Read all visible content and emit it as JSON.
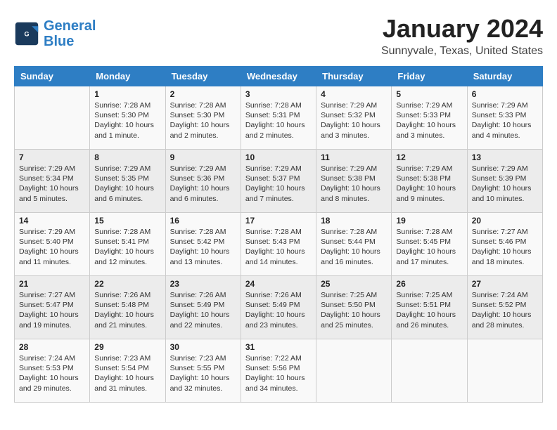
{
  "header": {
    "title": "January 2024",
    "subtitle": "Sunnyvale, Texas, United States",
    "logo_general": "General",
    "logo_blue": "Blue"
  },
  "columns": [
    "Sunday",
    "Monday",
    "Tuesday",
    "Wednesday",
    "Thursday",
    "Friday",
    "Saturday"
  ],
  "weeks": [
    [
      {
        "day": "",
        "info": ""
      },
      {
        "day": "1",
        "info": "Sunrise: 7:28 AM\nSunset: 5:30 PM\nDaylight: 10 hours\nand 1 minute."
      },
      {
        "day": "2",
        "info": "Sunrise: 7:28 AM\nSunset: 5:30 PM\nDaylight: 10 hours\nand 2 minutes."
      },
      {
        "day": "3",
        "info": "Sunrise: 7:28 AM\nSunset: 5:31 PM\nDaylight: 10 hours\nand 2 minutes."
      },
      {
        "day": "4",
        "info": "Sunrise: 7:29 AM\nSunset: 5:32 PM\nDaylight: 10 hours\nand 3 minutes."
      },
      {
        "day": "5",
        "info": "Sunrise: 7:29 AM\nSunset: 5:33 PM\nDaylight: 10 hours\nand 3 minutes."
      },
      {
        "day": "6",
        "info": "Sunrise: 7:29 AM\nSunset: 5:33 PM\nDaylight: 10 hours\nand 4 minutes."
      }
    ],
    [
      {
        "day": "7",
        "info": "Sunrise: 7:29 AM\nSunset: 5:34 PM\nDaylight: 10 hours\nand 5 minutes."
      },
      {
        "day": "8",
        "info": "Sunrise: 7:29 AM\nSunset: 5:35 PM\nDaylight: 10 hours\nand 6 minutes."
      },
      {
        "day": "9",
        "info": "Sunrise: 7:29 AM\nSunset: 5:36 PM\nDaylight: 10 hours\nand 6 minutes."
      },
      {
        "day": "10",
        "info": "Sunrise: 7:29 AM\nSunset: 5:37 PM\nDaylight: 10 hours\nand 7 minutes."
      },
      {
        "day": "11",
        "info": "Sunrise: 7:29 AM\nSunset: 5:38 PM\nDaylight: 10 hours\nand 8 minutes."
      },
      {
        "day": "12",
        "info": "Sunrise: 7:29 AM\nSunset: 5:38 PM\nDaylight: 10 hours\nand 9 minutes."
      },
      {
        "day": "13",
        "info": "Sunrise: 7:29 AM\nSunset: 5:39 PM\nDaylight: 10 hours\nand 10 minutes."
      }
    ],
    [
      {
        "day": "14",
        "info": "Sunrise: 7:29 AM\nSunset: 5:40 PM\nDaylight: 10 hours\nand 11 minutes."
      },
      {
        "day": "15",
        "info": "Sunrise: 7:28 AM\nSunset: 5:41 PM\nDaylight: 10 hours\nand 12 minutes."
      },
      {
        "day": "16",
        "info": "Sunrise: 7:28 AM\nSunset: 5:42 PM\nDaylight: 10 hours\nand 13 minutes."
      },
      {
        "day": "17",
        "info": "Sunrise: 7:28 AM\nSunset: 5:43 PM\nDaylight: 10 hours\nand 14 minutes."
      },
      {
        "day": "18",
        "info": "Sunrise: 7:28 AM\nSunset: 5:44 PM\nDaylight: 10 hours\nand 16 minutes."
      },
      {
        "day": "19",
        "info": "Sunrise: 7:28 AM\nSunset: 5:45 PM\nDaylight: 10 hours\nand 17 minutes."
      },
      {
        "day": "20",
        "info": "Sunrise: 7:27 AM\nSunset: 5:46 PM\nDaylight: 10 hours\nand 18 minutes."
      }
    ],
    [
      {
        "day": "21",
        "info": "Sunrise: 7:27 AM\nSunset: 5:47 PM\nDaylight: 10 hours\nand 19 minutes."
      },
      {
        "day": "22",
        "info": "Sunrise: 7:26 AM\nSunset: 5:48 PM\nDaylight: 10 hours\nand 21 minutes."
      },
      {
        "day": "23",
        "info": "Sunrise: 7:26 AM\nSunset: 5:49 PM\nDaylight: 10 hours\nand 22 minutes."
      },
      {
        "day": "24",
        "info": "Sunrise: 7:26 AM\nSunset: 5:49 PM\nDaylight: 10 hours\nand 23 minutes."
      },
      {
        "day": "25",
        "info": "Sunrise: 7:25 AM\nSunset: 5:50 PM\nDaylight: 10 hours\nand 25 minutes."
      },
      {
        "day": "26",
        "info": "Sunrise: 7:25 AM\nSunset: 5:51 PM\nDaylight: 10 hours\nand 26 minutes."
      },
      {
        "day": "27",
        "info": "Sunrise: 7:24 AM\nSunset: 5:52 PM\nDaylight: 10 hours\nand 28 minutes."
      }
    ],
    [
      {
        "day": "28",
        "info": "Sunrise: 7:24 AM\nSunset: 5:53 PM\nDaylight: 10 hours\nand 29 minutes."
      },
      {
        "day": "29",
        "info": "Sunrise: 7:23 AM\nSunset: 5:54 PM\nDaylight: 10 hours\nand 31 minutes."
      },
      {
        "day": "30",
        "info": "Sunrise: 7:23 AM\nSunset: 5:55 PM\nDaylight: 10 hours\nand 32 minutes."
      },
      {
        "day": "31",
        "info": "Sunrise: 7:22 AM\nSunset: 5:56 PM\nDaylight: 10 hours\nand 34 minutes."
      },
      {
        "day": "",
        "info": ""
      },
      {
        "day": "",
        "info": ""
      },
      {
        "day": "",
        "info": ""
      }
    ]
  ]
}
